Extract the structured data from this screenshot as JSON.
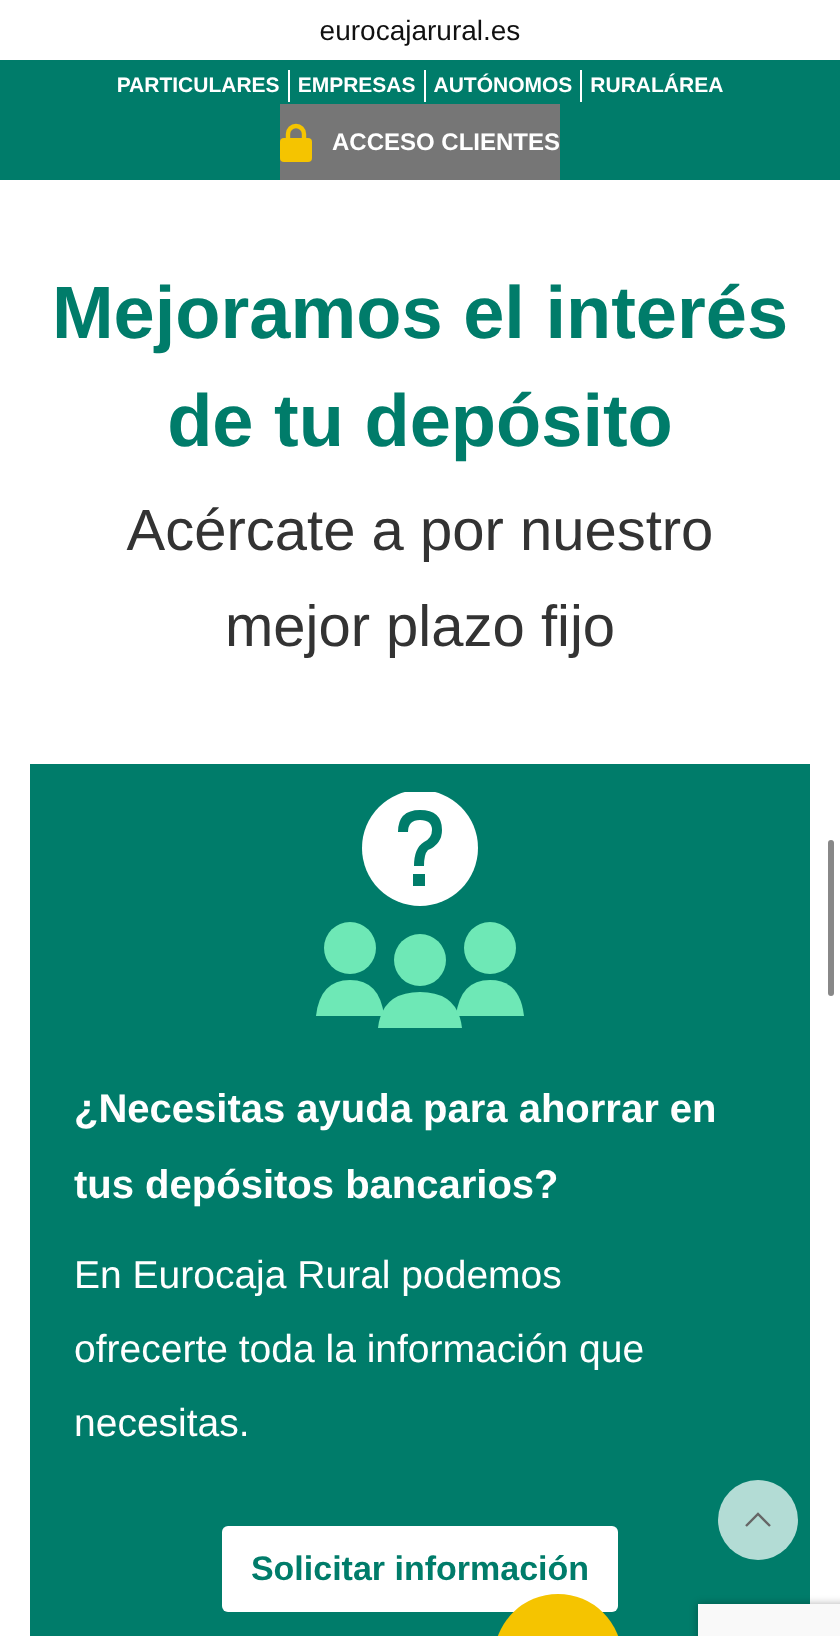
{
  "address_bar": {
    "url": "eurocajarural.es"
  },
  "nav": {
    "items": [
      {
        "label": "PARTICULARES"
      },
      {
        "label": "EMPRESAS"
      },
      {
        "label": "AUTÓNOMOS"
      },
      {
        "label": "RURALÁREA"
      }
    ],
    "login_button": "ACCESO CLIENTES"
  },
  "hero": {
    "title": "Mejoramos el interés de tu depósito",
    "subtitle": "Acércate a por nuestro mejor plazo fijo"
  },
  "help_card": {
    "question": "¿Necesitas ayuda para ahorrar en tus depósitos bancarios?",
    "text": "En Eurocaja Rural podemos ofrecerte toda la información que necesitas.",
    "button": "Solicitar información"
  }
}
